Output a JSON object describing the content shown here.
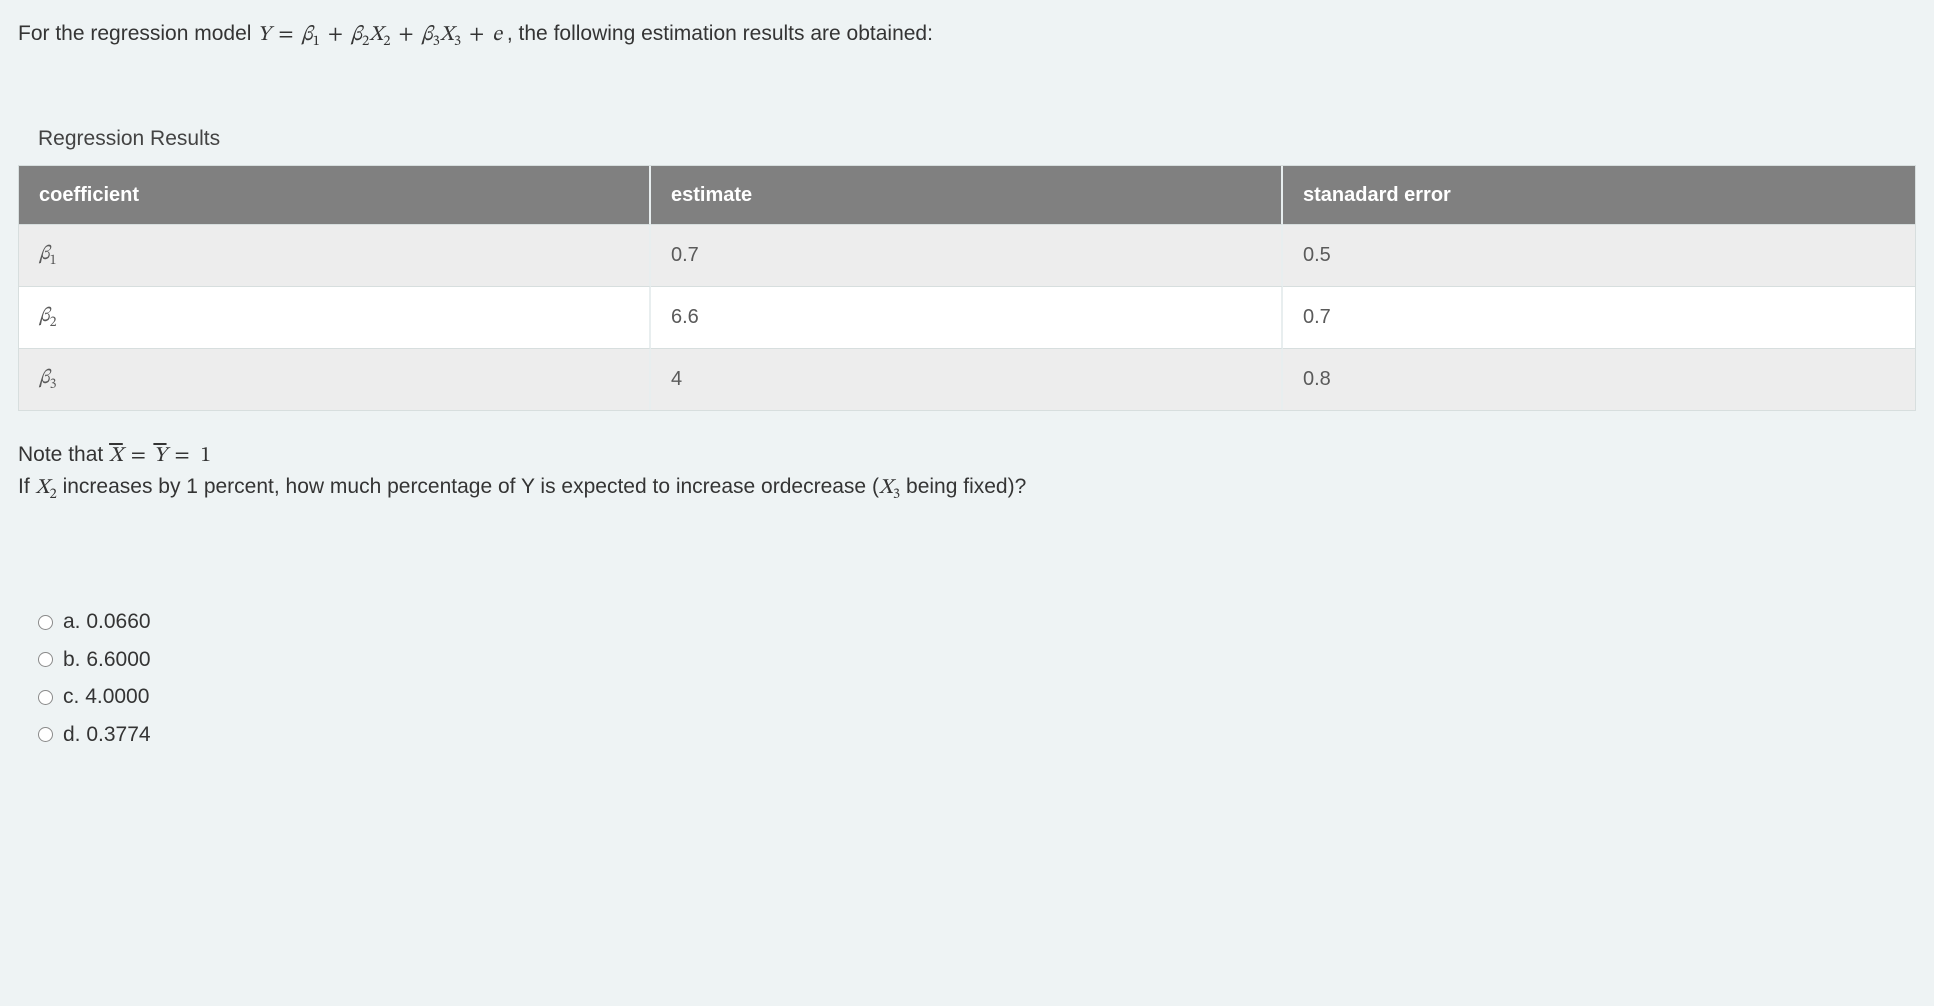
{
  "intro": {
    "prefix": "For the regression model ",
    "suffix": ", the following estimation results are obtained:"
  },
  "equation": {
    "Y": "Y",
    "eq": "=",
    "b1": "β",
    "s1": "1",
    "plus": "+",
    "b2": "β",
    "s2": "2",
    "X2": "X",
    "xs2": "2",
    "b3": "β",
    "s3": "3",
    "X3": "X",
    "xs3": "3",
    "e": "e"
  },
  "table": {
    "caption": "Regression Results",
    "headers": [
      "coefficient",
      "estimate",
      "stanadard error"
    ],
    "rows": [
      {
        "coef_base": "β",
        "coef_sub": "1",
        "estimate": "0.7",
        "stderr": "0.5"
      },
      {
        "coef_base": "β",
        "coef_sub": "2",
        "estimate": "6.6",
        "stderr": "0.7"
      },
      {
        "coef_base": "β",
        "coef_sub": "3",
        "estimate": "4",
        "stderr": "0.8"
      }
    ]
  },
  "note": {
    "prefix": "Note that ",
    "Xbar": "X",
    "eq": "=",
    "Ybar": "Y",
    "one": "1"
  },
  "question": {
    "p1": "If ",
    "X2b": "X",
    "X2s": "2",
    "p2": " increases by 1 percent, how much percentage of Y is expected to increase ordecrease (",
    "X3b": "X",
    "X3s": "3",
    "p3": "  being fixed)?"
  },
  "options": [
    {
      "letter": "a.",
      "text": "0.0660"
    },
    {
      "letter": "b.",
      "text": "6.6000"
    },
    {
      "letter": "c.",
      "text": "4.0000"
    },
    {
      "letter": "d.",
      "text": "0.3774"
    }
  ]
}
